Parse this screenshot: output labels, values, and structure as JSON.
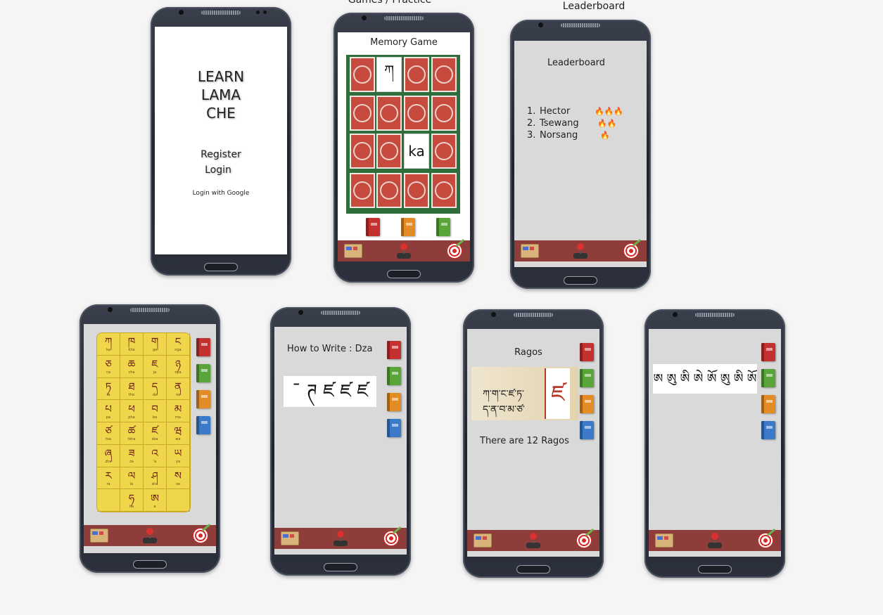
{
  "frame_labels": {
    "games": "Games / Practice",
    "leaderboard": "Leaderboard"
  },
  "login": {
    "title_line1": "LEARN",
    "title_line2": "LAMA",
    "title_line3": "CHE",
    "register": "Register",
    "login": "Login",
    "google": "Login with Google"
  },
  "memory": {
    "title": "Memory Game",
    "card_tibetan": "ཀ",
    "card_latin": "ka"
  },
  "leaderboard": {
    "title": "Leaderboard",
    "entries": [
      {
        "rank": "1.",
        "name": "Hector",
        "flames": "🔥🔥🔥"
      },
      {
        "rank": "2.",
        "name": "Tsewang",
        "flames": "🔥🔥"
      },
      {
        "rank": "3.",
        "name": "Norsang",
        "flames": "🔥"
      }
    ]
  },
  "alphabet": {
    "letters": [
      "ཀ",
      "ཁ",
      "ག",
      "ང",
      "ཅ",
      "ཆ",
      "ཇ",
      "ཉ",
      "ཏ",
      "ཐ",
      "ད",
      "ན",
      "པ",
      "ཕ",
      "བ",
      "མ",
      "ཙ",
      "ཚ",
      "ཛ",
      "ཝ",
      "ཞ",
      "ཟ",
      "འ",
      "ཡ",
      "ར",
      "ལ",
      "ཤ",
      "ས",
      "",
      "ཧ",
      "ཨ",
      ""
    ],
    "romans": [
      "ka",
      "kha",
      "ga",
      "nga",
      "ca",
      "cha",
      "ja",
      "nya",
      "ta",
      "tha",
      "da",
      "na",
      "pa",
      "pha",
      "ba",
      "ma",
      "tsa",
      "tsha",
      "dza",
      "wa",
      "zha",
      "za",
      "'a",
      "ya",
      "ra",
      "la",
      "sha",
      "sa",
      "",
      "ha",
      "a",
      ""
    ]
  },
  "write": {
    "title": "How to Write : Dza",
    "strokes": "ˉ ཊ ཛ ཛ ཛ"
  },
  "ragos": {
    "title": "Ragos",
    "line1": "ཀ་ག་ང་ཛ་ཏ་",
    "line2": "ད་ན་བ་མ་ཙ་",
    "big": "ཛ",
    "caption": "There are 12 Ragos"
  },
  "vowels": {
    "strip": "ཨ ཨུ ཨི ཨེ ཨོ ཨུ ཨི ཨོ"
  },
  "colors": {
    "nav": "#8e3d3a",
    "board_green": "#2f6e3c",
    "card_red": "#c64b3e",
    "alphabet_yellow": "#f0d64b"
  },
  "icons": [
    "box-icon",
    "joystick-icon",
    "target-icon",
    "book-icon"
  ]
}
